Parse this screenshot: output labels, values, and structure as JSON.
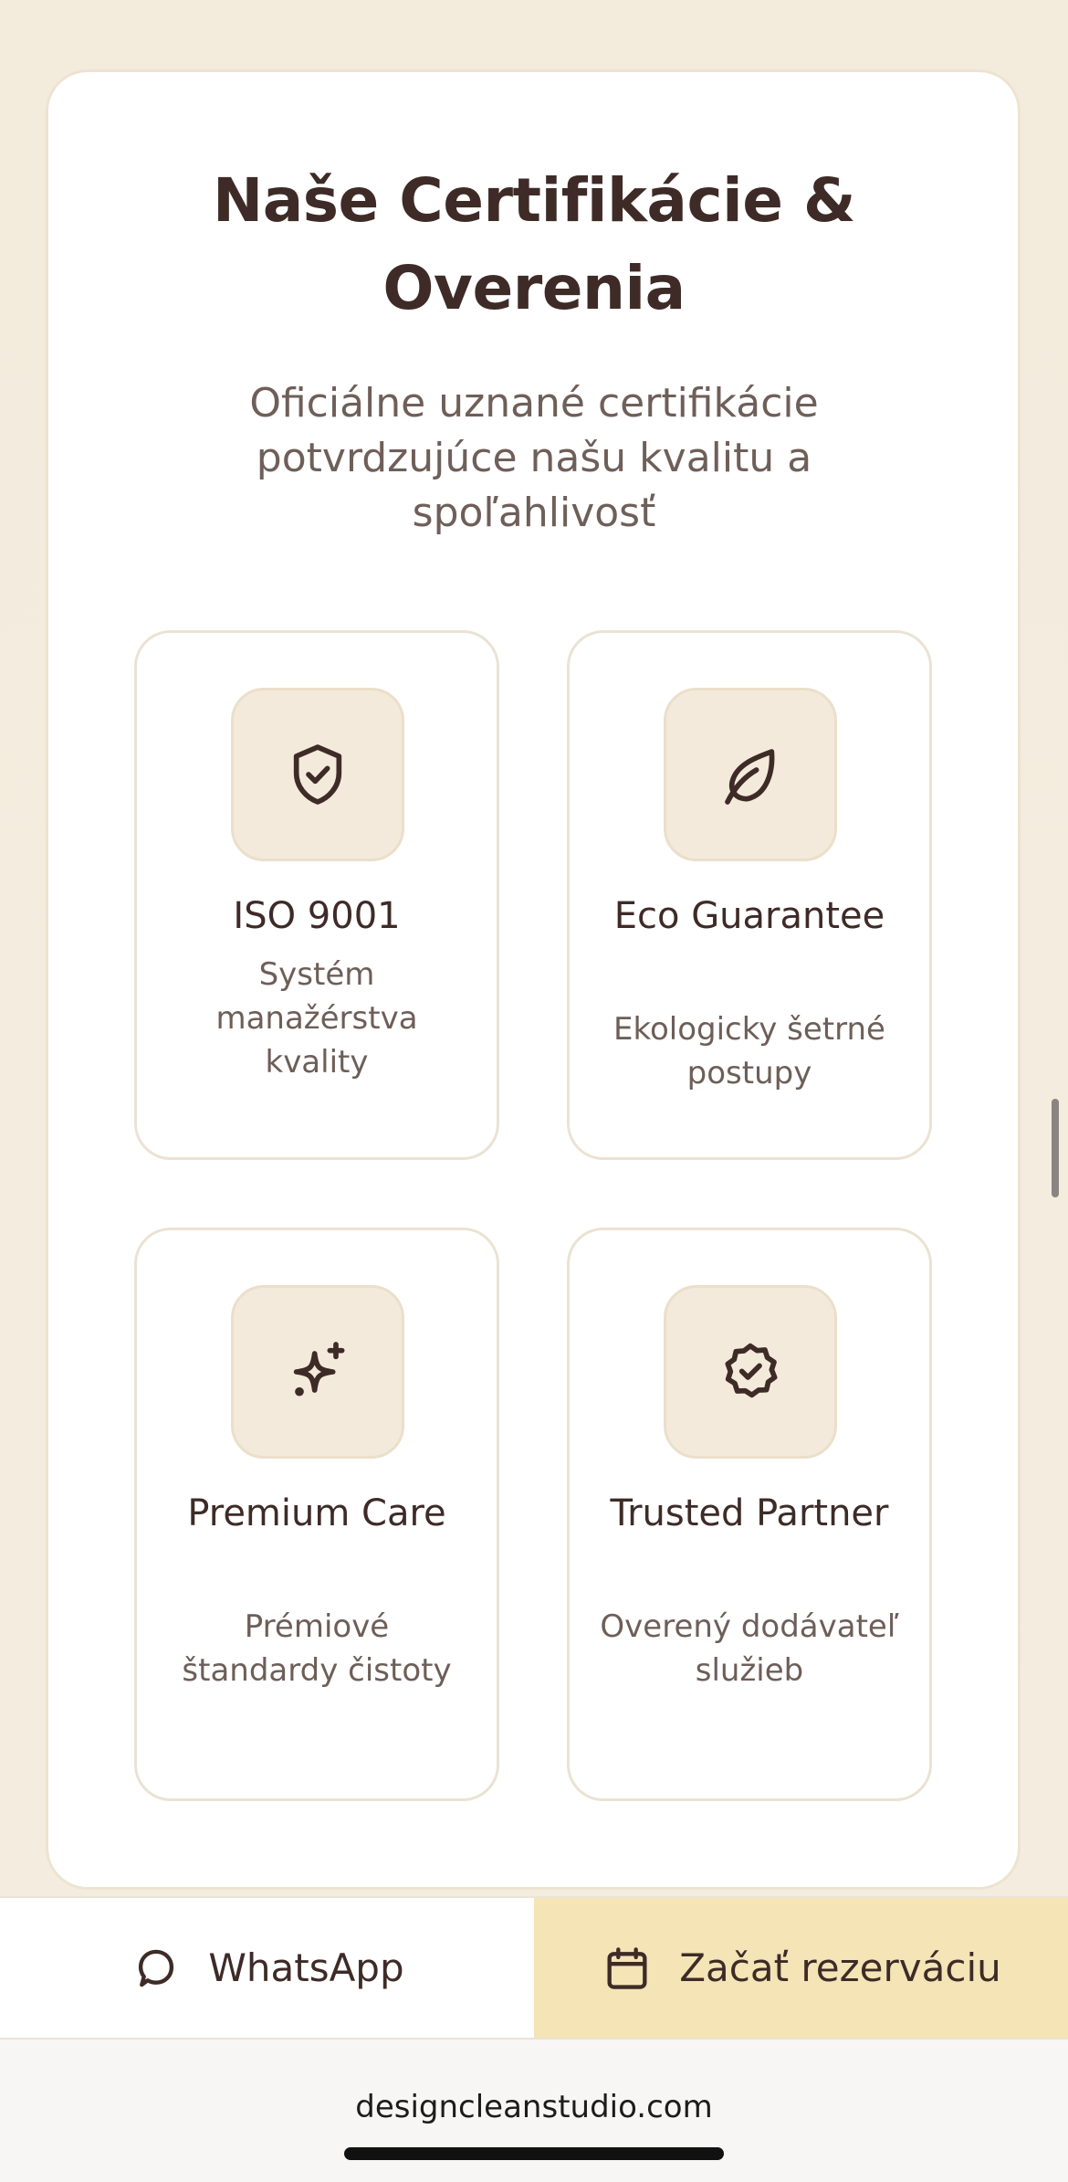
{
  "section": {
    "title": "Naše Certifikácie & Overenia",
    "subtitle": "Oficiálne uznané certifikácie potvrdzujúce našu kvalitu a spoľahlivosť"
  },
  "certifications": [
    {
      "icon": "shield-check-icon",
      "title": "ISO 9001",
      "description": "Systém manažérstva kvality"
    },
    {
      "icon": "leaf-icon",
      "title": "Eco Guarantee",
      "description": "Ekologicky šetrné postupy"
    },
    {
      "icon": "sparkles-icon",
      "title": "Premium Care",
      "description": "Prémiové štandardy čistoty"
    },
    {
      "icon": "badge-check-icon",
      "title": "Trusted Partner",
      "description": "Overený dodávateľ služieb"
    }
  ],
  "bottom_bar": {
    "whatsapp_label": "WhatsApp",
    "booking_label": "Začať rezerváciu"
  },
  "browser": {
    "url": "designcleanstudio.com"
  },
  "colors": {
    "background": "#f3ebdd",
    "text_primary": "#3e2b27",
    "text_secondary": "#6d5e58",
    "icon_tile": "#f3eadb",
    "booking_button": "#f4e4b6"
  }
}
